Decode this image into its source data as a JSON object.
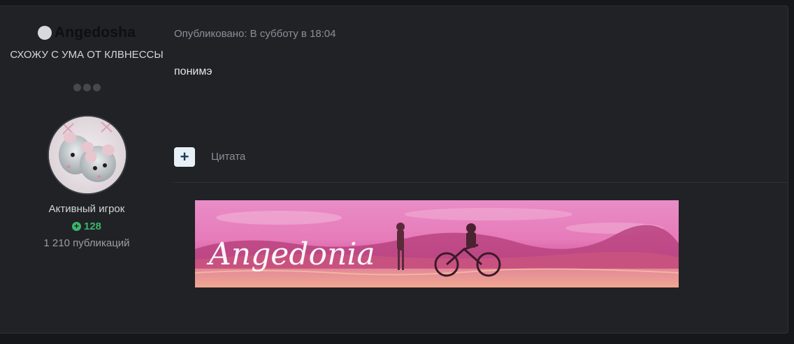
{
  "author": {
    "name": "Angedosha",
    "title": "СХОЖУ С УМА ОТ КЛВНЕССЫ",
    "rank": "Активный игрок",
    "reputation": "128",
    "posts": "1 210 публикаций",
    "avatar_icon": "avatar-image"
  },
  "post": {
    "published": "Опубликовано: В субботу в 18:04",
    "text": "понимэ",
    "quote_icon": "+",
    "quote_label": "Цитата"
  },
  "signature": {
    "text": "Angedonia"
  },
  "colors": {
    "background": "#15171b",
    "panel": "#202226",
    "reputation": "#3bb56c",
    "signature_pink": "#d85aa0"
  }
}
